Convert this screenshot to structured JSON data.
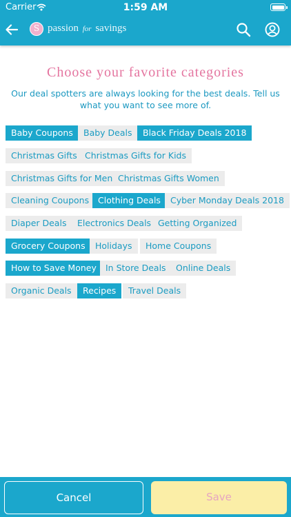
{
  "status_bar": {
    "carrier": "Carrier",
    "time": "1:59 AM"
  },
  "header": {
    "logo_letter": "S",
    "brand_left": "passion",
    "brand_mid": "for",
    "brand_right": "savings"
  },
  "page": {
    "title": "Choose your favorite categories",
    "subtitle": "Our deal spotters are always looking for the best deals. Tell us what you want to see more of."
  },
  "categories": [
    {
      "label": "Baby Coupons",
      "selected": true
    },
    {
      "label": "Baby Deals",
      "selected": false
    },
    {
      "label": "Black Friday Deals 2018",
      "selected": true
    },
    {
      "label": "Christmas Gifts",
      "selected": false
    },
    {
      "label": "Christmas Gifts for Kids",
      "selected": false
    },
    {
      "label": "Christmas Gifts for Men",
      "selected": false
    },
    {
      "label": "Christmas Gifts Women",
      "selected": false
    },
    {
      "label": "Cleaning Coupons",
      "selected": false
    },
    {
      "label": "Clothing Deals",
      "selected": true
    },
    {
      "label": "Cyber Monday Deals 2018",
      "selected": false
    },
    {
      "label": "Diaper Deals",
      "selected": false
    },
    {
      "label": "Electronics Deals",
      "selected": false
    },
    {
      "label": "Getting Organized",
      "selected": false
    },
    {
      "label": "Grocery Coupons",
      "selected": true
    },
    {
      "label": "Holidays",
      "selected": false
    },
    {
      "label": "Home Coupons",
      "selected": false
    },
    {
      "label": "How to Save Money",
      "selected": true
    },
    {
      "label": "In Store Deals",
      "selected": false
    },
    {
      "label": "Online Deals",
      "selected": false
    },
    {
      "label": "Organic Deals",
      "selected": false
    },
    {
      "label": "Recipes",
      "selected": true
    },
    {
      "label": "Travel Deals",
      "selected": false
    }
  ],
  "footer": {
    "cancel_label": "Cancel",
    "save_label": "Save"
  }
}
